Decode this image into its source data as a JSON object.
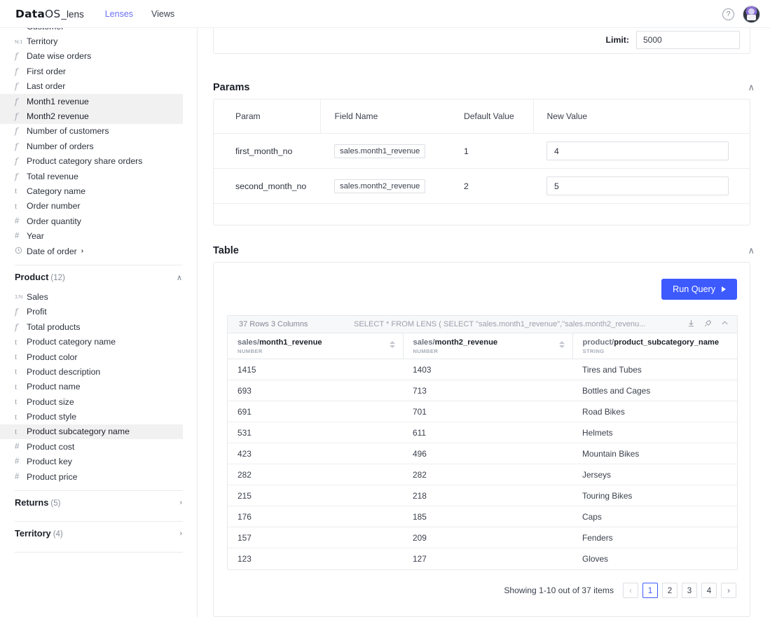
{
  "header": {
    "brand_data": "Data",
    "brand_os": "OS",
    "brand_lens": "_lens",
    "nav": [
      {
        "label": "Lenses",
        "active": true
      },
      {
        "label": "Views",
        "active": false
      }
    ],
    "help_icon": "question-mark-icon",
    "avatar": "user-avatar"
  },
  "sidebar": {
    "items": [
      {
        "icon": "N:1",
        "icon_kind": "rel",
        "label": "Customer",
        "selected": false
      },
      {
        "icon": "N:1",
        "icon_kind": "rel",
        "label": "Territory",
        "selected": false
      },
      {
        "icon": "f",
        "icon_kind": "fn",
        "label": "Date wise orders",
        "selected": false
      },
      {
        "icon": "f",
        "icon_kind": "fn",
        "label": "First order",
        "selected": false
      },
      {
        "icon": "f",
        "icon_kind": "fn",
        "label": "Last order",
        "selected": false
      },
      {
        "icon": "f",
        "icon_kind": "fn",
        "label": "Month1 revenue",
        "selected": true
      },
      {
        "icon": "f",
        "icon_kind": "fn",
        "label": "Month2 revenue",
        "selected": true
      },
      {
        "icon": "f",
        "icon_kind": "fn",
        "label": "Number of customers",
        "selected": false
      },
      {
        "icon": "f",
        "icon_kind": "fn",
        "label": "Number of orders",
        "selected": false
      },
      {
        "icon": "f",
        "icon_kind": "fn",
        "label": "Product category share orders",
        "selected": false
      },
      {
        "icon": "f",
        "icon_kind": "fn",
        "label": "Total revenue",
        "selected": false
      },
      {
        "icon": "t",
        "icon_kind": "txt",
        "label": "Category name",
        "selected": false
      },
      {
        "icon": "t",
        "icon_kind": "txt",
        "label": "Order number",
        "selected": false
      },
      {
        "icon": "#",
        "icon_kind": "hash",
        "label": "Order quantity",
        "selected": false
      },
      {
        "icon": "#",
        "icon_kind": "hash",
        "label": "Year",
        "selected": false
      },
      {
        "icon": "clock",
        "icon_kind": "clock",
        "label": "Date of order",
        "selected": false,
        "expand": "›"
      }
    ],
    "groups": [
      {
        "title": "Product",
        "count": "(12)",
        "expanded": true,
        "arrow": "∧",
        "items": [
          {
            "icon": "1:N",
            "icon_kind": "rel",
            "label": "Sales",
            "selected": false
          },
          {
            "icon": "f",
            "icon_kind": "fn",
            "label": "Profit",
            "selected": false
          },
          {
            "icon": "f",
            "icon_kind": "fn",
            "label": "Total products",
            "selected": false
          },
          {
            "icon": "t",
            "icon_kind": "txt",
            "label": "Product category name",
            "selected": false
          },
          {
            "icon": "t",
            "icon_kind": "txt",
            "label": "Product color",
            "selected": false
          },
          {
            "icon": "t",
            "icon_kind": "txt",
            "label": "Product description",
            "selected": false
          },
          {
            "icon": "t",
            "icon_kind": "txt",
            "label": "Product name",
            "selected": false
          },
          {
            "icon": "t",
            "icon_kind": "txt",
            "label": "Product size",
            "selected": false
          },
          {
            "icon": "t",
            "icon_kind": "txt",
            "label": "Product style",
            "selected": false
          },
          {
            "icon": "t",
            "icon_kind": "txt",
            "label": "Product subcategory name",
            "selected": true
          },
          {
            "icon": "#",
            "icon_kind": "hash",
            "label": "Product cost",
            "selected": false
          },
          {
            "icon": "#",
            "icon_kind": "hash",
            "label": "Product key",
            "selected": false
          },
          {
            "icon": "#",
            "icon_kind": "hash",
            "label": "Product price",
            "selected": false
          }
        ]
      },
      {
        "title": "Returns",
        "count": "(5)",
        "expanded": false,
        "arrow": "›",
        "items": []
      },
      {
        "title": "Territory",
        "count": "(4)",
        "expanded": false,
        "arrow": "›",
        "items": []
      }
    ]
  },
  "limit": {
    "label": "Limit:",
    "value": "5000",
    "placeholder": "5000"
  },
  "params": {
    "title": "Params",
    "collapse_arrow": "∧",
    "columns": [
      "Param",
      "Field Name",
      "Default Value",
      "New Value"
    ],
    "rows": [
      {
        "param": "first_month_no",
        "field_name": "sales.month1_revenue",
        "default_value": "1",
        "new_value": "4"
      },
      {
        "param": "second_month_no",
        "field_name": "sales.month2_revenue",
        "default_value": "2",
        "new_value": "5"
      }
    ]
  },
  "table_section": {
    "title": "Table",
    "collapse_arrow": "∧",
    "run_query_label": "Run Query",
    "results": {
      "row_count_text": "37 Rows 3 Columns",
      "sql": "SELECT * FROM LENS ( SELECT \"sales.month1_revenue\",\"sales.month2_revenu...",
      "tools": [
        "download-icon",
        "pin-icon",
        "collapse-icon"
      ],
      "columns": [
        {
          "prefix": "sales/",
          "name": "month1_revenue",
          "type": "NUMBER",
          "sortable": true
        },
        {
          "prefix": "sales/",
          "name": "month2_revenue",
          "type": "NUMBER",
          "sortable": true
        },
        {
          "prefix": "product/",
          "name": "product_subcategory_name",
          "type": "STRING",
          "sortable": false
        }
      ],
      "rows": [
        {
          "month1_revenue": "1415",
          "month2_revenue": "1403",
          "product_subcategory_name": "Tires and Tubes"
        },
        {
          "month1_revenue": "693",
          "month2_revenue": "713",
          "product_subcategory_name": "Bottles and Cages"
        },
        {
          "month1_revenue": "691",
          "month2_revenue": "701",
          "product_subcategory_name": "Road Bikes"
        },
        {
          "month1_revenue": "531",
          "month2_revenue": "611",
          "product_subcategory_name": "Helmets"
        },
        {
          "month1_revenue": "423",
          "month2_revenue": "496",
          "product_subcategory_name": "Mountain Bikes"
        },
        {
          "month1_revenue": "282",
          "month2_revenue": "282",
          "product_subcategory_name": "Jerseys"
        },
        {
          "month1_revenue": "215",
          "month2_revenue": "218",
          "product_subcategory_name": "Touring Bikes"
        },
        {
          "month1_revenue": "176",
          "month2_revenue": "185",
          "product_subcategory_name": "Caps"
        },
        {
          "month1_revenue": "157",
          "month2_revenue": "209",
          "product_subcategory_name": "Fenders"
        },
        {
          "month1_revenue": "123",
          "month2_revenue": "127",
          "product_subcategory_name": "Gloves"
        }
      ]
    },
    "pagination": {
      "showing_text": "Showing 1-10 out of 37 items",
      "prev": "‹",
      "next": "›",
      "pages": [
        "1",
        "2",
        "3",
        "4"
      ],
      "active_page": "1"
    }
  },
  "colors": {
    "accent_blue": "#3d5afe",
    "nav_active": "#6b6ff5",
    "selected_row": "#f1f1f2"
  }
}
